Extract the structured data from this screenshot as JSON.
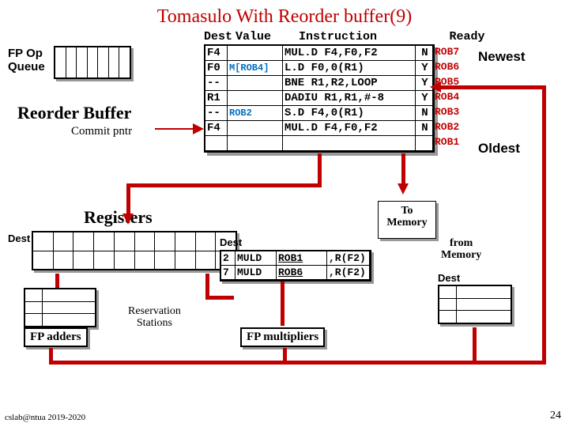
{
  "title": "Tomasulo With Reorder buffer(9)",
  "fp_queue_label_1": "FP Op",
  "fp_queue_label_2": "Queue",
  "rob_label": "Reorder Buffer",
  "commit_label": "Commit pntr",
  "rob_headers": {
    "dest": "Dest",
    "value": "Value",
    "instruction": "Instruction",
    "ready": "Ready"
  },
  "rob": {
    "rows": [
      {
        "dest": "F4",
        "value": "",
        "instruction": "MUL.D F4,F0,F2",
        "ready": "N",
        "id": "ROB7"
      },
      {
        "dest": "F0",
        "value": "M[ROB4]",
        "instruction": "L.D F0,0(R1)",
        "ready": "Y",
        "id": "ROB6"
      },
      {
        "dest": "--",
        "value": "",
        "instruction": "BNE R1,R2,LOOP",
        "ready": "Y",
        "id": "ROB5"
      },
      {
        "dest": "R1",
        "value": "",
        "instruction": "DADIU R1,R1,#-8",
        "ready": "Y",
        "id": "ROB4"
      },
      {
        "dest": "--",
        "value": "ROB2",
        "instruction": "S.D F4,0(R1)",
        "ready": "N",
        "id": "ROB3"
      },
      {
        "dest": "F4",
        "value": "",
        "instruction": "MUL.D F4,F0,F2",
        "ready": "N",
        "id": "ROB2"
      },
      {
        "dest": "",
        "value": "",
        "instruction": "",
        "ready": "",
        "id": "ROB1"
      }
    ]
  },
  "newest": "Newest",
  "oldest": "Oldest",
  "registers_label": "Registers",
  "dest_left": "Dest",
  "to_memory_l1": "To",
  "to_memory_l2": "Memory",
  "from_memory_l1": "from",
  "from_memory_l2": "Memory",
  "res_station_l1": "Reservation",
  "res_station_l2": "Stations",
  "rs_dest": "Dest",
  "rs": {
    "rows": [
      {
        "id": "2",
        "op": "MULD",
        "s1": "ROB1",
        "s2": ",R(F2)"
      },
      {
        "id": "7",
        "op": "MULD",
        "s1": "ROB6",
        "s2": ",R(F2)"
      }
    ]
  },
  "dest_right": "Dest",
  "fp_adders": "FP adders",
  "fp_mults": "FP multipliers",
  "footer_left": "cslab@ntua 2019-2020",
  "footer_right": "24"
}
